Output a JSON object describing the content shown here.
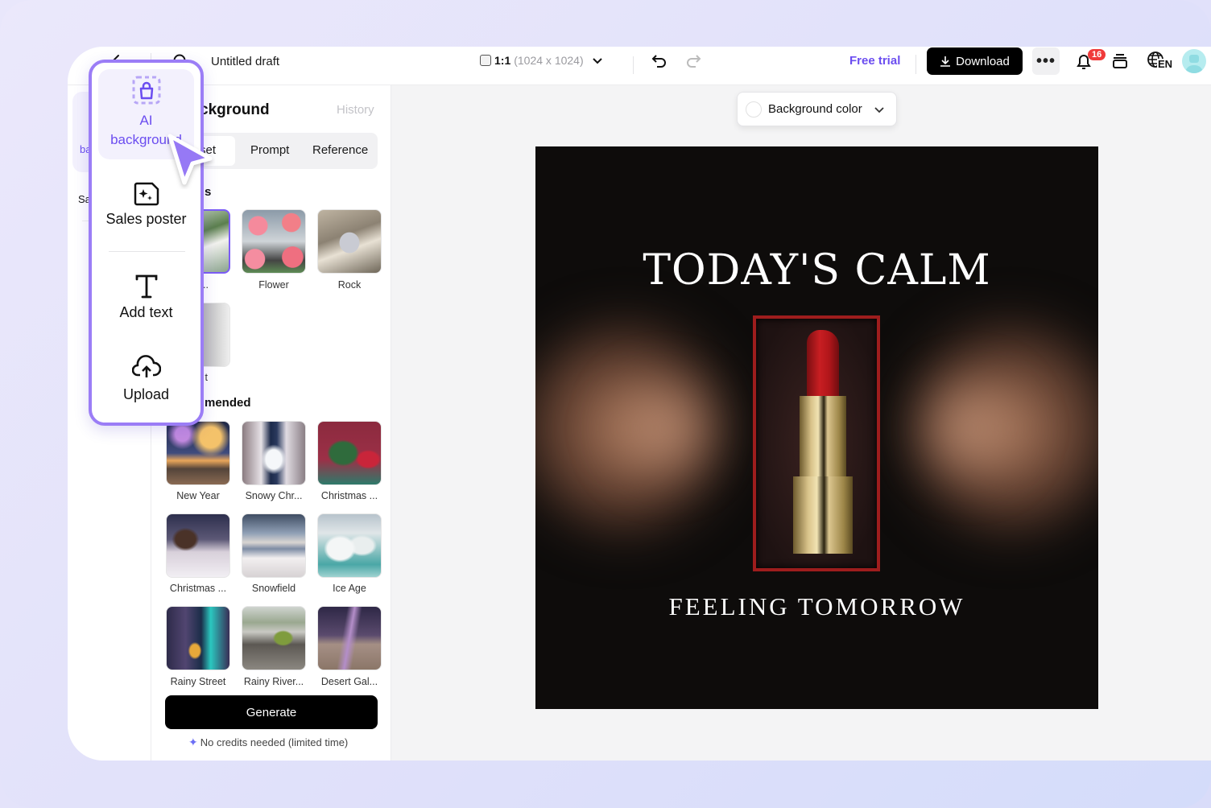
{
  "topbar": {
    "title": "Untitled draft",
    "ratio_label": "1:1",
    "ratio_dims": "(1024 x 1024)",
    "free_trial": "Free trial",
    "download": "Download",
    "more": "•••",
    "notifications_count": "16",
    "language": "EN",
    "accent_color": "#6b4df0"
  },
  "rail": {
    "items": [
      {
        "label": "ba",
        "icon": "ai-background-icon"
      },
      {
        "label": "Sa",
        "icon": "sales-poster-icon"
      }
    ]
  },
  "popup_menu": {
    "items": [
      {
        "label": "AI background",
        "icon": "ai-background-icon",
        "active": true
      },
      {
        "label": "Sales poster",
        "icon": "sales-poster-icon"
      },
      {
        "label": "Add text",
        "icon": "text-icon"
      },
      {
        "label": "Upload",
        "icon": "upload-cloud-icon"
      }
    ]
  },
  "panel": {
    "title": "AI background",
    "title_visible": "ckground",
    "history": "History",
    "tabs": [
      {
        "label": "Preset",
        "visible": "set",
        "active": true
      },
      {
        "label": "Prompt"
      },
      {
        "label": "Reference"
      }
    ],
    "presets_label": "s",
    "presets": [
      {
        "label": "n ...",
        "selected": true
      },
      {
        "label": "Flower"
      },
      {
        "label": "Rock"
      },
      {
        "label": "t"
      }
    ],
    "recommended_label": "mended",
    "recommended": [
      {
        "label": "New Year"
      },
      {
        "label": "Snowy Chr..."
      },
      {
        "label": "Christmas ..."
      },
      {
        "label": "Christmas ..."
      },
      {
        "label": "Snowfield"
      },
      {
        "label": "Ice Age"
      },
      {
        "label": "Rainy Street"
      },
      {
        "label": "Rainy River..."
      },
      {
        "label": "Desert Gal..."
      }
    ],
    "generate": "Generate",
    "credits_note": "No credits needed (limited time)"
  },
  "canvas": {
    "bg_color_label": "Background color",
    "poster_headline": "TODAY'S CALM",
    "poster_subline": "FEELING TOMORROW"
  }
}
